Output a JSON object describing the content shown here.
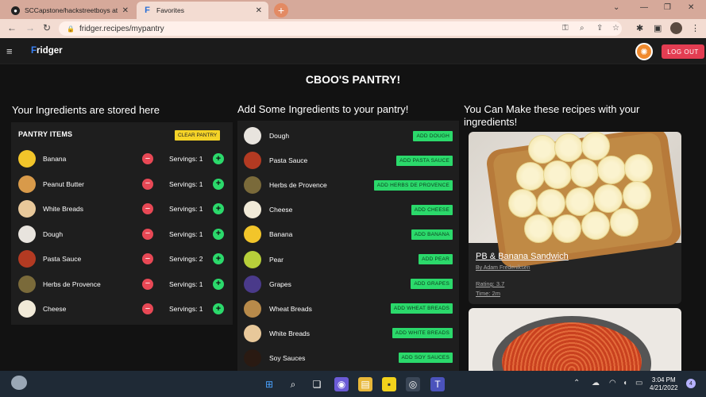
{
  "browser": {
    "tabs": [
      {
        "title": "SCCapstone/hackstreetboys at m",
        "active": false
      },
      {
        "title": "Favorites",
        "active": true
      }
    ],
    "url": "fridger.recipes/mypantry"
  },
  "app": {
    "brand_first": "F",
    "brand_rest": "ridger",
    "logout_label": "LOG OUT",
    "page_title": "CBOO'S PANTRY!"
  },
  "columns": {
    "pantry_heading": "Your Ingredients are stored here",
    "add_heading": "Add Some Ingredients to your pantry!",
    "recipes_heading": "You Can Make these recipes with your ingredients!"
  },
  "pantry": {
    "header": "PANTRY ITEMS",
    "clear_label": "CLEAR PANTRY",
    "items": [
      {
        "name": "Banana",
        "servings": "Servings: 1",
        "color": "#f2c52a"
      },
      {
        "name": "Peanut Butter",
        "servings": "Servings: 1",
        "color": "#d89a4a"
      },
      {
        "name": "White Breads",
        "servings": "Servings: 1",
        "color": "#e8c89a"
      },
      {
        "name": "Dough",
        "servings": "Servings: 1",
        "color": "#e8e4de"
      },
      {
        "name": "Pasta Sauce",
        "servings": "Servings: 2",
        "color": "#b33a22"
      },
      {
        "name": "Herbs de Provence",
        "servings": "Servings: 1",
        "color": "#7a6a3a"
      },
      {
        "name": "Cheese",
        "servings": "Servings: 1",
        "color": "#f1ead8"
      }
    ]
  },
  "add_list": [
    {
      "name": "Dough",
      "button": "ADD DOUGH",
      "color": "#e8e4de"
    },
    {
      "name": "Pasta Sauce",
      "button": "ADD PASTA SAUCE",
      "color": "#b33a22"
    },
    {
      "name": "Herbs de Provence",
      "button": "ADD HERBS DE PROVENCE",
      "color": "#7a6a3a"
    },
    {
      "name": "Cheese",
      "button": "ADD CHEESE",
      "color": "#f1ead8"
    },
    {
      "name": "Banana",
      "button": "ADD BANANA",
      "color": "#f2c52a"
    },
    {
      "name": "Pear",
      "button": "ADD PEAR",
      "color": "#b7cf3a"
    },
    {
      "name": "Grapes",
      "button": "ADD GRAPES",
      "color": "#4a3a8a"
    },
    {
      "name": "Wheat Breads",
      "button": "ADD WHEAT BREADS",
      "color": "#b88a4a"
    },
    {
      "name": "White Breads",
      "button": "ADD WHITE BREADS",
      "color": "#e8c89a"
    },
    {
      "name": "Soy Sauces",
      "button": "ADD SOY SAUCES",
      "color": "#2a1a12"
    }
  ],
  "recipes": [
    {
      "title": "PB & Banana Sandwich",
      "author": "By Adam Fredeniksen",
      "rating": "Rating: 3.7",
      "time": "Time: 2m"
    }
  ],
  "taskbar": {
    "time": "3:04 PM",
    "date": "4/21/2022",
    "notifications": "4"
  }
}
